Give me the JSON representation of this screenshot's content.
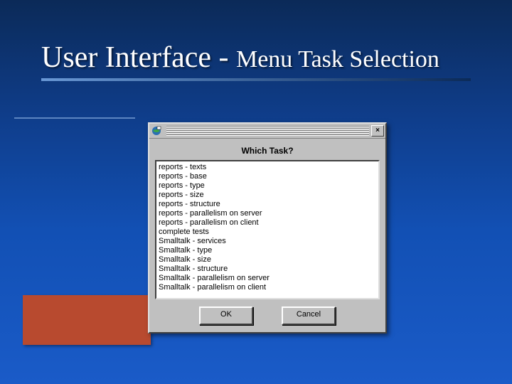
{
  "slide": {
    "title_main": "User Interface - ",
    "title_sub": "Menu Task Selection"
  },
  "dialog": {
    "close_glyph": "×",
    "prompt": "Which Task?",
    "items": [
      "reports - texts",
      "reports - base",
      "reports - type",
      "reports - size",
      "reports - structure",
      "reports - parallelism on server",
      "reports - parallelism on client",
      "complete tests",
      "Smalltalk - services",
      "Smalltalk - type",
      "Smalltalk - size",
      "Smalltalk - structure",
      "Smalltalk - parallelism on server",
      "Smalltalk - parallelism on client"
    ],
    "ok_label": "OK",
    "cancel_label": "Cancel"
  }
}
